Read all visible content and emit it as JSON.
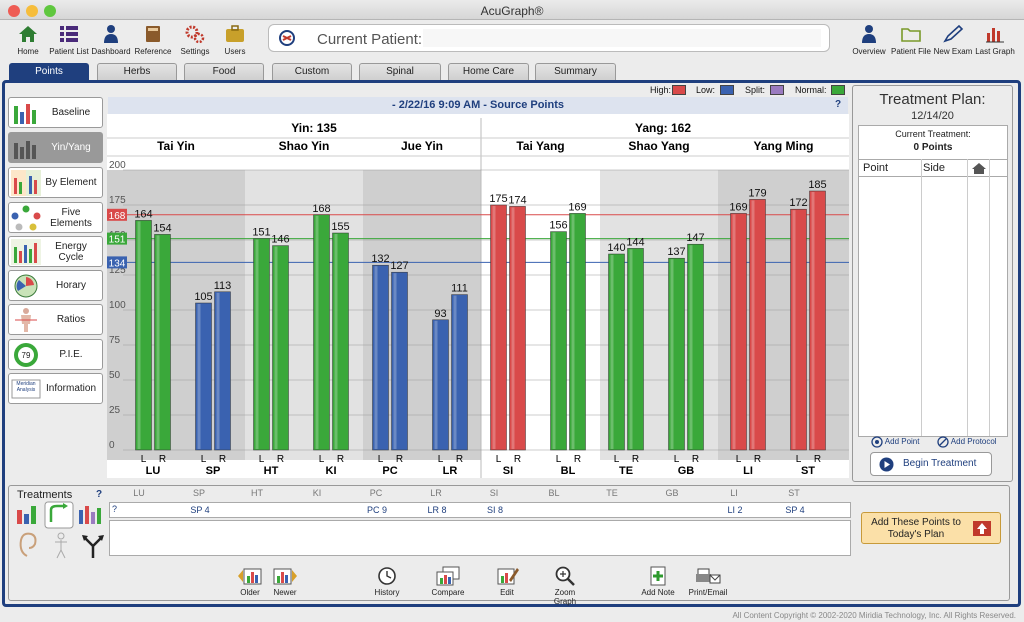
{
  "window": {
    "title": "AcuGraph®"
  },
  "toolbar": {
    "left": [
      "Home",
      "Patient List",
      "Dashboard",
      "Reference",
      "Settings",
      "Users"
    ],
    "current_patient_label": "Current Patient:",
    "current_patient_value": "",
    "right": [
      "Overview",
      "Patient File",
      "New Exam",
      "Last Graph"
    ]
  },
  "tabs": [
    "Points",
    "Herbs",
    "Food",
    "Custom",
    "Spinal",
    "Home Care",
    "Summary"
  ],
  "active_tab": "Points",
  "sidebar": [
    "Baseline",
    "Yin/Yang",
    "By Element",
    "Five Elements",
    "Energy Cycle",
    "Horary",
    "Ratios",
    "P.I.E.",
    "Information"
  ],
  "sidebar_active": "Yin/Yang",
  "sidebar_thumb_texts": {
    "pie": "79",
    "info": "Meridian Analysis"
  },
  "legend": [
    {
      "label": "High:",
      "color": "#d94a4a"
    },
    {
      "label": "Low:",
      "color": "#3a62b0"
    },
    {
      "label": "Split:",
      "color": "#9a7bc0"
    },
    {
      "label": "Normal:",
      "color": "#3aa83a"
    }
  ],
  "graph": {
    "title": "- 2/22/16 9:09 AM - Source Points",
    "help": "?",
    "yin_header": "Yin: 135",
    "yang_header": "Yang: 162",
    "groups": [
      "Tai Yin",
      "Shao Yin",
      "Jue Yin",
      "Tai Yang",
      "Shao Yang",
      "Yang Ming"
    ]
  },
  "chart_data": {
    "type": "bar",
    "categories": [
      "LU",
      "SP",
      "HT",
      "KI",
      "PC",
      "LR",
      "SI",
      "BL",
      "TE",
      "GB",
      "LI",
      "ST"
    ],
    "sides": [
      "L",
      "R"
    ],
    "values_L": [
      164,
      105,
      151,
      168,
      132,
      93,
      175,
      156,
      140,
      137,
      169,
      172
    ],
    "values_R": [
      154,
      113,
      146,
      155,
      127,
      111,
      174,
      169,
      144,
      147,
      179,
      185
    ],
    "status": [
      "normal",
      "low",
      "normal",
      "normal",
      "low",
      "low",
      "high",
      "normal",
      "normal",
      "normal",
      "high",
      "high"
    ],
    "colors": {
      "normal": "#3aa83a",
      "low": "#3a62b0",
      "high": "#d94a4a"
    },
    "ylim": [
      0,
      200
    ],
    "yticks": [
      0,
      25,
      50,
      75,
      100,
      125,
      150,
      175,
      200
    ],
    "ref_lines": [
      {
        "value": 168,
        "color": "#d94a4a"
      },
      {
        "value": 151,
        "color": "#3aa83a"
      },
      {
        "value": 134,
        "color": "#3a62b0"
      }
    ]
  },
  "treatment_plan": {
    "title": "Treatment Plan:",
    "date": "12/14/20",
    "current_label": "Current Treatment:",
    "points_count": "0 Points",
    "col_point": "Point",
    "col_side": "Side",
    "add_point": "Add Point",
    "add_protocol": "Add Protocol",
    "begin": "Begin Treatment"
  },
  "treatments": {
    "title": "Treatments",
    "help": "?",
    "row_help": "?",
    "columns": [
      "LU",
      "SP",
      "HT",
      "KI",
      "PC",
      "LR",
      "SI",
      "BL",
      "TE",
      "GB",
      "LI",
      "ST"
    ],
    "values": [
      "",
      "SP 4",
      "",
      "",
      "PC 9",
      "LR 8",
      "SI 8",
      "",
      "",
      "",
      "LI 2",
      "SP 4"
    ],
    "add_button": "Add These Points to Today's Plan"
  },
  "bottom": [
    "Older",
    "Newer",
    "History",
    "Compare",
    "Edit",
    "Zoom Graph",
    "Add Note",
    "Print/Email"
  ],
  "copyright": "All Content Copyright © 2002-2020 Miridia Technology, Inc.  All Rights Reserved."
}
